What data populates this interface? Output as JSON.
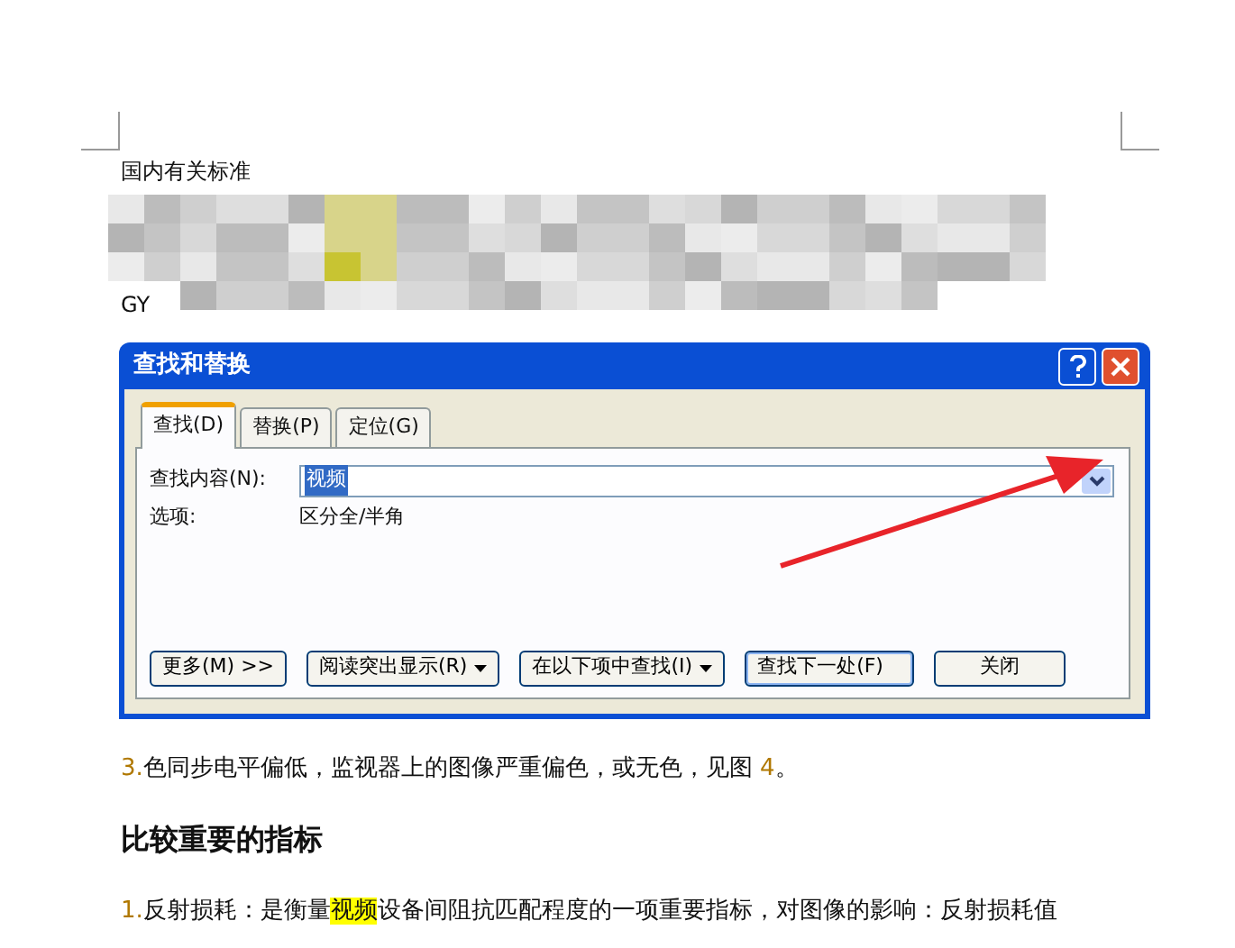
{
  "document": {
    "heading": "国内有关标准",
    "partial_line": "GY",
    "paragraphs": [
      {
        "kind": "text",
        "segments": [
          {
            "kind": "number",
            "text": "3."
          },
          {
            "kind": "plain",
            "text": "色同步电平偏低，监视器上的图像严重偏色，或无色，见图 "
          },
          {
            "kind": "number",
            "text": "4"
          },
          {
            "kind": "plain",
            "text": "。"
          }
        ]
      },
      {
        "kind": "heading",
        "segments": [
          {
            "kind": "plain",
            "text": "比较重要的指标"
          }
        ]
      },
      {
        "kind": "text",
        "segments": [
          {
            "kind": "number",
            "text": "1."
          },
          {
            "kind": "plain",
            "text": "反射损耗：是衡量"
          },
          {
            "kind": "highlight",
            "text": "视频"
          },
          {
            "kind": "plain",
            "text": "设备间阻抗匹配程度的一项重要指标，对图像的影响：反射损耗值"
          }
        ]
      }
    ]
  },
  "dialog": {
    "title": "查找和替换",
    "tabs": [
      {
        "label": "查找(D)",
        "selected": true
      },
      {
        "label": "替换(P)",
        "selected": false
      },
      {
        "label": "定位(G)",
        "selected": false
      }
    ],
    "find_label": "查找内容(N):",
    "find_value": "视频",
    "options_label": "选项:",
    "options_value": "区分全/半角",
    "buttons": [
      {
        "label": "更多(M) >>",
        "kind": "plain",
        "default": false
      },
      {
        "label": "阅读突出显示(R)",
        "kind": "menu",
        "default": false
      },
      {
        "label": "在以下项中查找(I)",
        "kind": "menu",
        "default": false
      },
      {
        "label": "查找下一处(F)",
        "kind": "plain",
        "default": true
      },
      {
        "label": "关闭",
        "kind": "plain",
        "default": false
      }
    ]
  }
}
